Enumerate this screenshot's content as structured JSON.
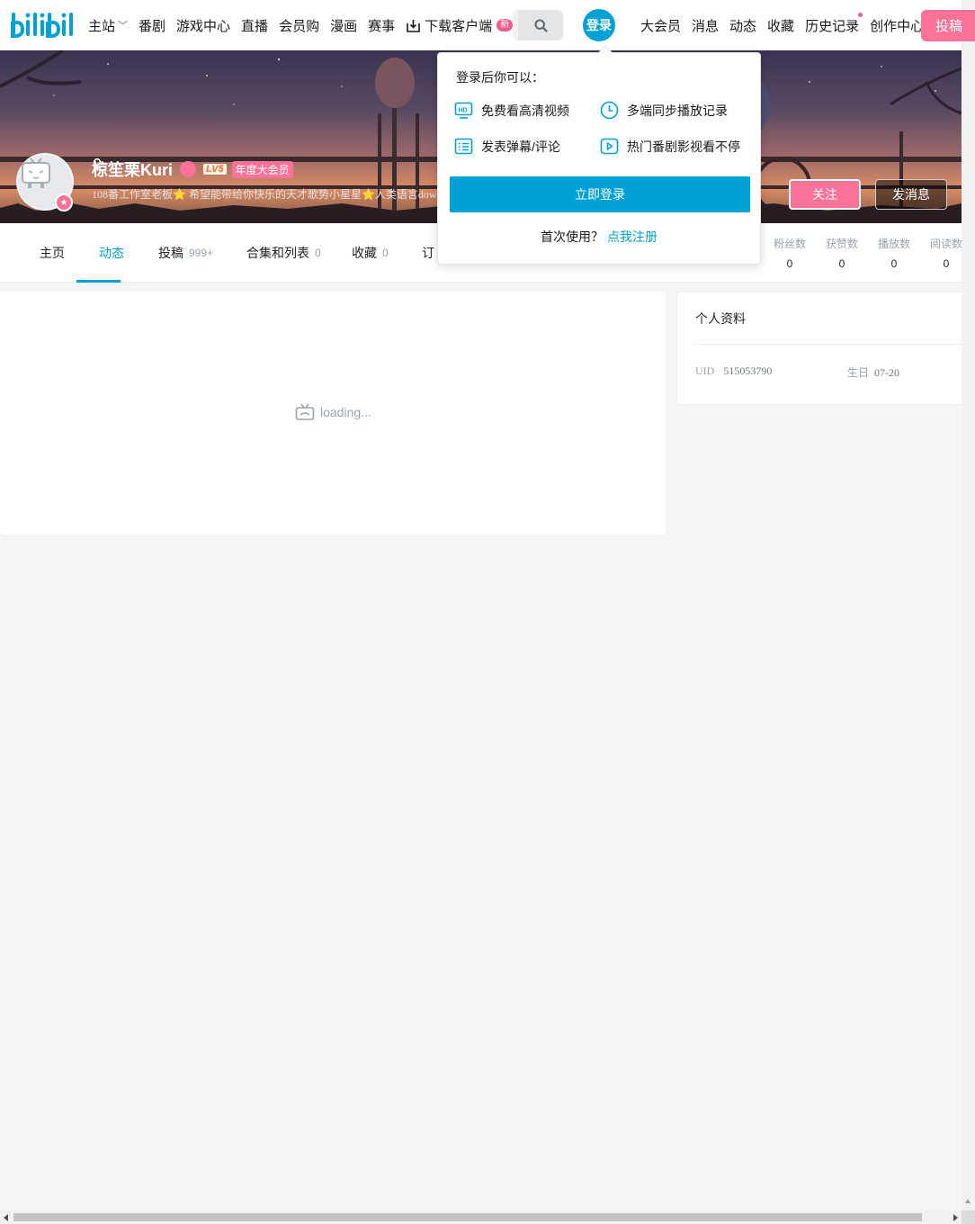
{
  "nav": {
    "logo_text": "bilibili",
    "left_items": [
      {
        "label": "主站",
        "has_chevron": true
      },
      {
        "label": "番剧"
      },
      {
        "label": "游戏中心"
      },
      {
        "label": "直播"
      },
      {
        "label": "会员购"
      },
      {
        "label": "漫画"
      },
      {
        "label": "赛事"
      }
    ],
    "download": {
      "label": "下载客户端",
      "badge": "新"
    },
    "login": "登录",
    "right_items": [
      {
        "label": "大会员"
      },
      {
        "label": "消息"
      },
      {
        "label": "动态"
      },
      {
        "label": "收藏"
      },
      {
        "label": "历史记录",
        "dot": true
      },
      {
        "label": "创作中心"
      }
    ],
    "upload": "投稿"
  },
  "profile": {
    "name": "椋笙栗Kuri",
    "level": "LV5",
    "vip": "年度大会员",
    "sign": "108番工作室老板⭐ 希望能带给你快乐的天才歌势小星星⭐人类语言dow",
    "follow": "关注",
    "message": "发消息"
  },
  "tabs": [
    {
      "label": "主页",
      "count": ""
    },
    {
      "label": "动态",
      "count": "",
      "active": true
    },
    {
      "label": "投稿",
      "count": "999+"
    },
    {
      "label": "合集和列表",
      "count": "0"
    },
    {
      "label": "收藏",
      "count": "0"
    },
    {
      "label": "订",
      "count": ""
    }
  ],
  "stats": [
    {
      "label": "粉丝数",
      "value": "0"
    },
    {
      "label": "获赞数",
      "value": "0"
    },
    {
      "label": "播放数",
      "value": "0"
    },
    {
      "label": "阅读数",
      "value": "0"
    }
  ],
  "main": {
    "loading": "loading..."
  },
  "side": {
    "title": "个人资料",
    "uid_label": "UID",
    "uid_value": "515053790",
    "birthday_label": "生日",
    "birthday_value": "07-20"
  },
  "popover": {
    "title": "登录后你可以：",
    "features": [
      {
        "icon": "hd-icon",
        "label": "免费看高清视频"
      },
      {
        "icon": "clock-icon",
        "label": "多端同步播放记录"
      },
      {
        "icon": "list-icon",
        "label": "发表弹幕/评论"
      },
      {
        "icon": "play-icon",
        "label": "热门番剧影视看不停"
      }
    ],
    "login_button": "立即登录",
    "register_prompt": "首次使用？",
    "register_link": "点我注册"
  },
  "colors": {
    "accent": "#00a1d6",
    "pink": "#fb7299"
  }
}
